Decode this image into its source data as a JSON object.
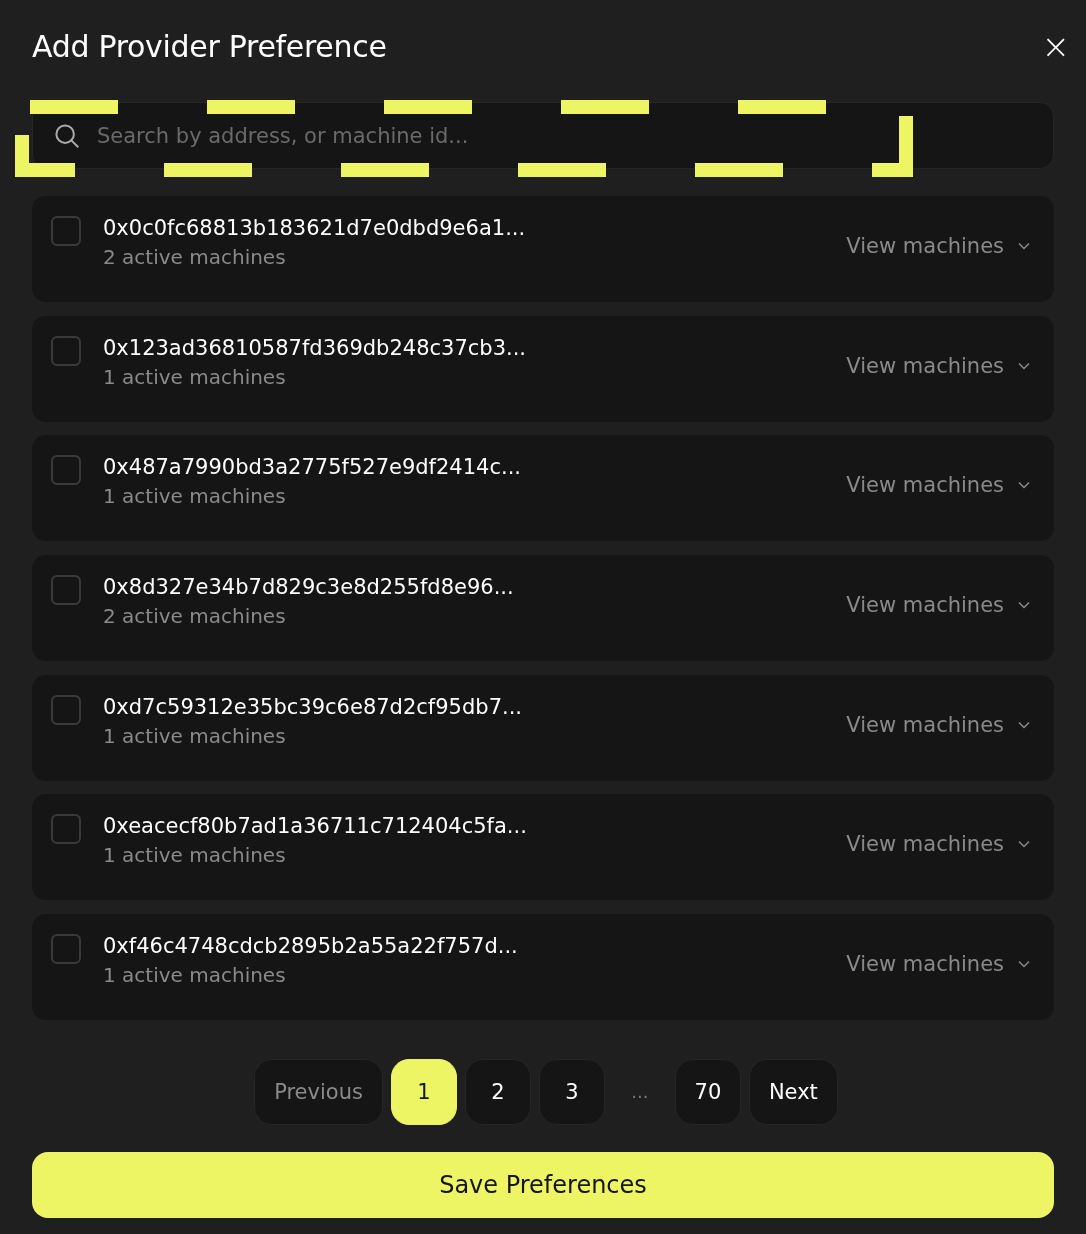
{
  "dialog": {
    "title": "Add Provider Preference",
    "close_label": "×"
  },
  "search": {
    "placeholder": "Search by address, or machine id...",
    "highlighted": true
  },
  "providers": [
    {
      "address": "0x0c0fc68813b183621d7e0dbd9e6a1...",
      "machines": "2 active machines",
      "checked": false,
      "action": "View machines",
      "expanded": false
    },
    {
      "address": "0x123ad36810587fd369db248c37cb3...",
      "machines": "1 active machines",
      "checked": false,
      "action": "View machines",
      "expanded": false
    },
    {
      "address": "0x487a7990bd3a2775f527e9df2414c...",
      "machines": "1 active machines",
      "checked": false,
      "action": "View machines",
      "expanded": false
    },
    {
      "address": "0x8d327e34b7d829c3e8d255fd8e96...",
      "machines": "2 active machines",
      "checked": false,
      "action": "View machines",
      "expanded": false
    },
    {
      "address": "0xd7c59312e35bc39c6e87d2cf95db7...",
      "machines": "1 active machines",
      "checked": false,
      "action": "View machines",
      "expanded": false
    },
    {
      "address": "0xeacecf80b7ad1a36711c712404c5fa...",
      "machines": "1 active machines",
      "checked": false,
      "action": "View machines",
      "expanded": false
    },
    {
      "address": "0xf46c4748cdcb2895b2a55a22f757d...",
      "machines": "1 active machines",
      "checked": false,
      "action": "View machines",
      "expanded": false
    }
  ],
  "pagination": {
    "previous": {
      "label": "Previous",
      "disabled": true
    },
    "pages": [
      {
        "kind": "page",
        "label": "1",
        "selected": true
      },
      {
        "kind": "page",
        "label": "2",
        "selected": false
      },
      {
        "kind": "page",
        "label": "3",
        "selected": false
      },
      {
        "kind": "ellipsis",
        "label": "..."
      },
      {
        "kind": "page",
        "label": "70",
        "selected": false
      }
    ],
    "next": {
      "label": "Next",
      "disabled": false
    }
  },
  "save_button": "Save Preferences"
}
